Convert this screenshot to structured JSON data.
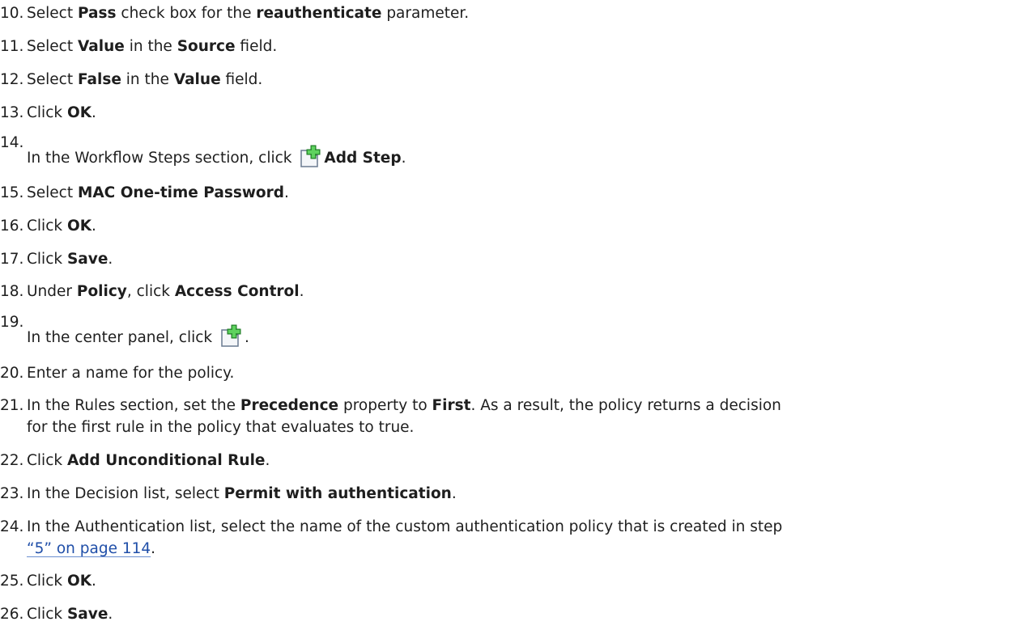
{
  "steps": [
    {
      "num": "10.",
      "t1": "Select ",
      "b1": "Pass",
      "t2": " check box for the ",
      "b2": "reauthenticate",
      "t3": " parameter."
    },
    {
      "num": "11.",
      "t1": "Select ",
      "b1": "Value",
      "t2": " in the ",
      "b2": "Source",
      "t3": " field."
    },
    {
      "num": "12.",
      "t1": "Select ",
      "b1": "False",
      "t2": " in the ",
      "b2": "Value",
      "t3": " field."
    },
    {
      "num": "13.",
      "t1": "Click ",
      "b1": "OK",
      "t2": "."
    },
    {
      "num": "14.",
      "t1": "In the Workflow Steps section, click ",
      "b1": "Add Step",
      "t2": "."
    },
    {
      "num": "15.",
      "t1": "Select ",
      "b1": "MAC One-time Password",
      "t2": "."
    },
    {
      "num": "16.",
      "t1": "Click ",
      "b1": "OK",
      "t2": "."
    },
    {
      "num": "17.",
      "t1": "Click ",
      "b1": "Save",
      "t2": "."
    },
    {
      "num": "18.",
      "t1": "Under ",
      "b1": "Policy",
      "t2": ", click ",
      "b2": "Access Control",
      "t3": "."
    },
    {
      "num": "19.",
      "t1": "In the center panel, click ",
      "t2": "."
    },
    {
      "num": "20.",
      "t1": "Enter a name for the policy."
    },
    {
      "num": "21.",
      "t1": "In the Rules section, set the ",
      "b1": "Precedence",
      "t2": " property to ",
      "b2": "First",
      "t3": ". As a result, the policy returns a decision",
      "line2": "for the first rule in the policy that evaluates to true."
    },
    {
      "num": "22.",
      "t1": "Click ",
      "b1": "Add Unconditional Rule",
      "t2": "."
    },
    {
      "num": "23.",
      "t1": "In the Decision list, select ",
      "b1": "Permit with authentication",
      "t2": "."
    },
    {
      "num": "24.",
      "t1": "In the Authentication list, select the name of the custom authentication policy that is created in step",
      "link": "“5” on page 114",
      "t2": "."
    },
    {
      "num": "25.",
      "t1": "Click ",
      "b1": "OK",
      "t2": "."
    },
    {
      "num": "26.",
      "t1": "Click ",
      "b1": "Save",
      "t2": "."
    }
  ],
  "icons": {
    "add_step_icon": "add-document-icon",
    "add_policy_icon": "add-document-icon",
    "icon_accent": "#3cb043"
  }
}
